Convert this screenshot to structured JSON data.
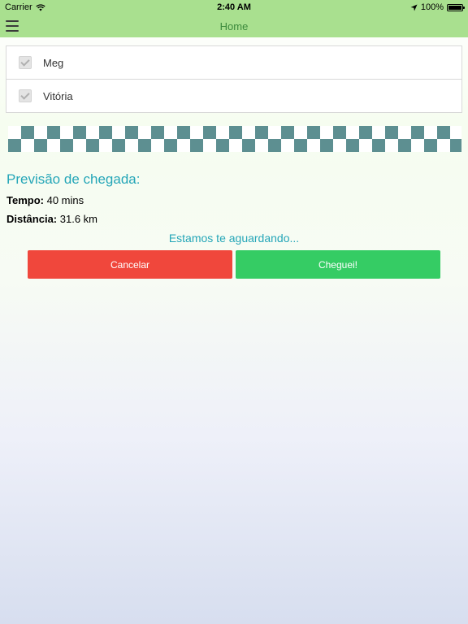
{
  "status_bar": {
    "carrier": "Carrier",
    "time": "2:40 AM",
    "battery": "100%"
  },
  "nav": {
    "title": "Home"
  },
  "passengers": [
    {
      "name": "Meg"
    },
    {
      "name": "Vitória"
    }
  ],
  "arrival": {
    "title": "Previsão de chegada:",
    "time_label": "Tempo:",
    "time_value": "40 mins",
    "distance_label": "Distância:",
    "distance_value": "31.6 km"
  },
  "waiting_text": "Estamos te aguardando...",
  "buttons": {
    "cancel": "Cancelar",
    "arrived": "Cheguei!"
  },
  "colors": {
    "cancel": "#f0473c",
    "arrived": "#35cc64",
    "checker_dark": "#5d8f91",
    "header": "#a9e08f",
    "accent": "#25a6b8"
  },
  "icons": {
    "menu": "hamburger-menu-icon",
    "wifi": "wifi-icon",
    "location": "location-arrow-icon",
    "battery": "battery-icon",
    "checkbox": "checkmark-icon"
  }
}
